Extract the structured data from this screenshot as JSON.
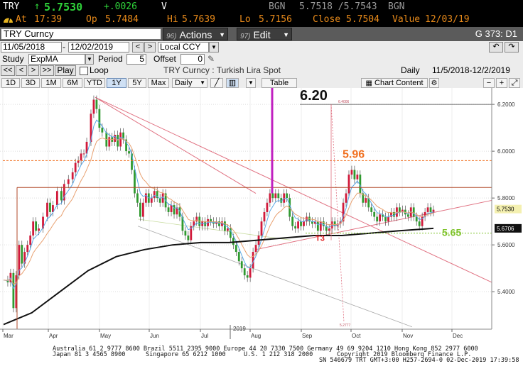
{
  "quote": {
    "ticker": "TRY",
    "arrow": "↑",
    "last": "5.7530",
    "change": "+.0026",
    "flag": "V",
    "source1": "BGN",
    "bid_ask": "5.7518 /5.7543",
    "source2": "BGN",
    "at_label": "At",
    "at_time": "17:39",
    "op_label": "Op",
    "op_value": "5.7484",
    "hi_label": "Hi",
    "hi_value": "5.7639",
    "lo_label": "Lo",
    "lo_value": "5.7156",
    "close_label": "Close",
    "close_value": "5.7504",
    "value_label": "Value",
    "value_date": "12/03/19"
  },
  "titlebar": {
    "security": "TRY Curncy",
    "actions_num": "96)",
    "actions_label": "Actions",
    "edit_num": "97)",
    "edit_label": "Edit",
    "page_code": "G 373: D1"
  },
  "range_row": {
    "start_date": "11/05/2018",
    "end_date": "12/02/2019",
    "currency": "Local CCY",
    "nav_prev": "<",
    "nav_next": ">",
    "undo": "↶",
    "redo": "↷"
  },
  "study_row": {
    "study_label": "Study",
    "study_value": "ExpMA",
    "period_label": "Period",
    "period_value": "5",
    "offset_label": "Offset",
    "offset_value": "0"
  },
  "play_row": {
    "btn_first": "<<",
    "btn_prev": "<",
    "btn_next": ">",
    "btn_last": ">>",
    "play": "Play",
    "loop": "Loop",
    "chart_title": "TRY Curncy : Turkish Lira Spot",
    "frequency": "Daily",
    "period_range": "11/5/2018-12/2/2019"
  },
  "ranges_row": {
    "ranges": [
      "1D",
      "3D",
      "1M",
      "6M",
      "YTD",
      "1Y",
      "5Y",
      "Max"
    ],
    "active_range": "1Y",
    "frequency_select": "Daily",
    "table_label": "Table",
    "chart_content_label": "Chart Content"
  },
  "colors": {
    "quote_green": "#2fd23a",
    "quote_gray": "#9a9a9a",
    "quote_orange": "#e88a1a",
    "annotation_orange": "#f07020",
    "annotation_green": "#7fc32b",
    "annotation_red": "#e02020",
    "spike_magenta": "#c020c0",
    "candle_red": "#d11a3b",
    "candle_green": "#2f9a2f"
  },
  "chart_data": {
    "type": "candlestick",
    "frequency": "Daily",
    "ylim": [
      5.24,
      6.27
    ],
    "yticks": [
      "6.2000",
      "6.0000",
      "5.8000",
      "5.6000",
      "5.4000"
    ],
    "ytick_values": [
      6.2,
      6.0,
      5.8,
      5.6,
      5.4
    ],
    "months": [
      "Mar",
      "Apr",
      "May",
      "Jun",
      "Jul",
      "Aug",
      "Sep",
      "Oct",
      "Nov",
      "Dec"
    ],
    "year_label": "2019",
    "last_price_label": "5.7530",
    "last_price": 5.753,
    "ma_label": "5.6706",
    "ma_value": 5.6706,
    "annotations": [
      {
        "text": "6.20",
        "value": 6.2
      },
      {
        "text": "5.96",
        "value": 5.96
      },
      {
        "text": "5.65",
        "value": 5.65
      },
      {
        "text": "T3",
        "value": 5.63
      }
    ],
    "small_labels": [
      "6.4006",
      "5.2777"
    ],
    "horizontal_levels": [
      6.2,
      5.96,
      5.845,
      5.65
    ],
    "close_path": [
      [
        0,
        5.45
      ],
      [
        6,
        5.44
      ],
      [
        10,
        5.48
      ],
      [
        14,
        5.33
      ],
      [
        18,
        5.47
      ],
      [
        22,
        5.6
      ],
      [
        26,
        5.52
      ],
      [
        30,
        5.57
      ],
      [
        34,
        5.6
      ],
      [
        38,
        5.64
      ],
      [
        42,
        5.7
      ],
      [
        46,
        5.66
      ],
      [
        50,
        5.67
      ],
      [
        56,
        5.72
      ],
      [
        62,
        5.78
      ],
      [
        66,
        5.74
      ],
      [
        70,
        5.77
      ],
      [
        76,
        5.83
      ],
      [
        82,
        5.79
      ],
      [
        86,
        5.86
      ],
      [
        92,
        5.88
      ],
      [
        98,
        5.91
      ],
      [
        102,
        5.95
      ],
      [
        106,
        5.96
      ],
      [
        110,
        5.99
      ],
      [
        114,
        5.99
      ],
      [
        118,
        6.04
      ],
      [
        124,
        6.16
      ],
      [
        128,
        6.22
      ],
      [
        132,
        6.18
      ],
      [
        136,
        6.1
      ],
      [
        140,
        6.08
      ],
      [
        146,
        6.02
      ],
      [
        150,
        6.06
      ],
      [
        154,
        6.04
      ],
      [
        158,
        6.07
      ],
      [
        162,
        6.02
      ],
      [
        166,
        6.08
      ],
      [
        170,
        6.05
      ],
      [
        174,
        6.0
      ],
      [
        178,
        5.99
      ],
      [
        182,
        5.92
      ],
      [
        186,
        5.82
      ],
      [
        190,
        5.78
      ],
      [
        194,
        5.72
      ],
      [
        198,
        5.78
      ],
      [
        202,
        5.82
      ],
      [
        206,
        5.78
      ],
      [
        210,
        5.8
      ],
      [
        214,
        5.83
      ],
      [
        218,
        5.8
      ],
      [
        222,
        5.78
      ],
      [
        226,
        5.82
      ],
      [
        230,
        5.76
      ],
      [
        234,
        5.74
      ],
      [
        238,
        5.77
      ],
      [
        242,
        5.73
      ],
      [
        246,
        5.76
      ],
      [
        250,
        5.72
      ],
      [
        254,
        5.66
      ],
      [
        258,
        5.64
      ],
      [
        262,
        5.62
      ],
      [
        266,
        5.68
      ],
      [
        270,
        5.7
      ],
      [
        274,
        5.72
      ],
      [
        278,
        5.68
      ],
      [
        282,
        5.7
      ],
      [
        286,
        5.68
      ],
      [
        290,
        5.71
      ],
      [
        294,
        5.7
      ],
      [
        298,
        5.69
      ],
      [
        302,
        5.7
      ],
      [
        306,
        5.68
      ],
      [
        310,
        5.7
      ],
      [
        314,
        5.66
      ],
      [
        318,
        5.67
      ],
      [
        322,
        5.63
      ],
      [
        326,
        5.6
      ],
      [
        330,
        5.57
      ],
      [
        334,
        5.53
      ],
      [
        338,
        5.5
      ],
      [
        342,
        5.47
      ],
      [
        346,
        5.46
      ],
      [
        350,
        5.5
      ],
      [
        354,
        5.57
      ],
      [
        358,
        5.6
      ],
      [
        362,
        5.64
      ],
      [
        366,
        5.7
      ],
      [
        370,
        5.74
      ],
      [
        374,
        5.78
      ],
      [
        378,
        5.82
      ],
      [
        382,
        5.8
      ],
      [
        386,
        5.82
      ],
      [
        390,
        5.8
      ],
      [
        394,
        5.78
      ],
      [
        398,
        5.82
      ],
      [
        402,
        5.8
      ],
      [
        406,
        5.72
      ],
      [
        410,
        5.68
      ],
      [
        414,
        5.67
      ],
      [
        418,
        5.7
      ],
      [
        422,
        5.68
      ],
      [
        426,
        5.7
      ],
      [
        430,
        5.72
      ],
      [
        434,
        5.7
      ],
      [
        438,
        5.69
      ],
      [
        442,
        5.7
      ],
      [
        446,
        5.66
      ],
      [
        450,
        5.7
      ],
      [
        454,
        5.68
      ],
      [
        458,
        5.66
      ],
      [
        462,
        5.67
      ],
      [
        466,
        5.7
      ],
      [
        470,
        5.68
      ],
      [
        474,
        5.69
      ],
      [
        478,
        5.7
      ],
      [
        482,
        5.78
      ],
      [
        486,
        5.82
      ],
      [
        490,
        5.9
      ],
      [
        494,
        5.92
      ],
      [
        498,
        5.88
      ],
      [
        502,
        5.9
      ],
      [
        506,
        5.82
      ],
      [
        510,
        5.78
      ],
      [
        514,
        5.8
      ],
      [
        518,
        5.76
      ],
      [
        522,
        5.74
      ],
      [
        526,
        5.72
      ],
      [
        530,
        5.7
      ],
      [
        534,
        5.73
      ],
      [
        538,
        5.72
      ],
      [
        542,
        5.7
      ],
      [
        546,
        5.72
      ],
      [
        550,
        5.74
      ],
      [
        554,
        5.72
      ],
      [
        558,
        5.76
      ],
      [
        562,
        5.74
      ],
      [
        566,
        5.75
      ],
      [
        570,
        5.73
      ],
      [
        574,
        5.72
      ],
      [
        578,
        5.76
      ],
      [
        582,
        5.72
      ],
      [
        586,
        5.7
      ],
      [
        590,
        5.68
      ],
      [
        594,
        5.72
      ],
      [
        598,
        5.74
      ],
      [
        602,
        5.76
      ],
      [
        606,
        5.74
      ],
      [
        610,
        5.75
      ]
    ]
  },
  "footer": {
    "line1": "Australia 61 2 9777 8600 Brazil 5511 2395 9000 Europe 44 20 7330 7500 Germany 49 69 9204 1210 Hong Kong 852 2977 6000",
    "line2a": "Japan 81 3 4565 8900",
    "line2b": "Singapore 65 6212 1000",
    "line2c": "U.S. 1 212 318 2000",
    "line2d": "Copyright 2019 Bloomberg Finance L.P.",
    "line3": "SN 546679 TRT  GMT+3:00 H257-2694-0 02-Dec-2019 17:39:58"
  }
}
